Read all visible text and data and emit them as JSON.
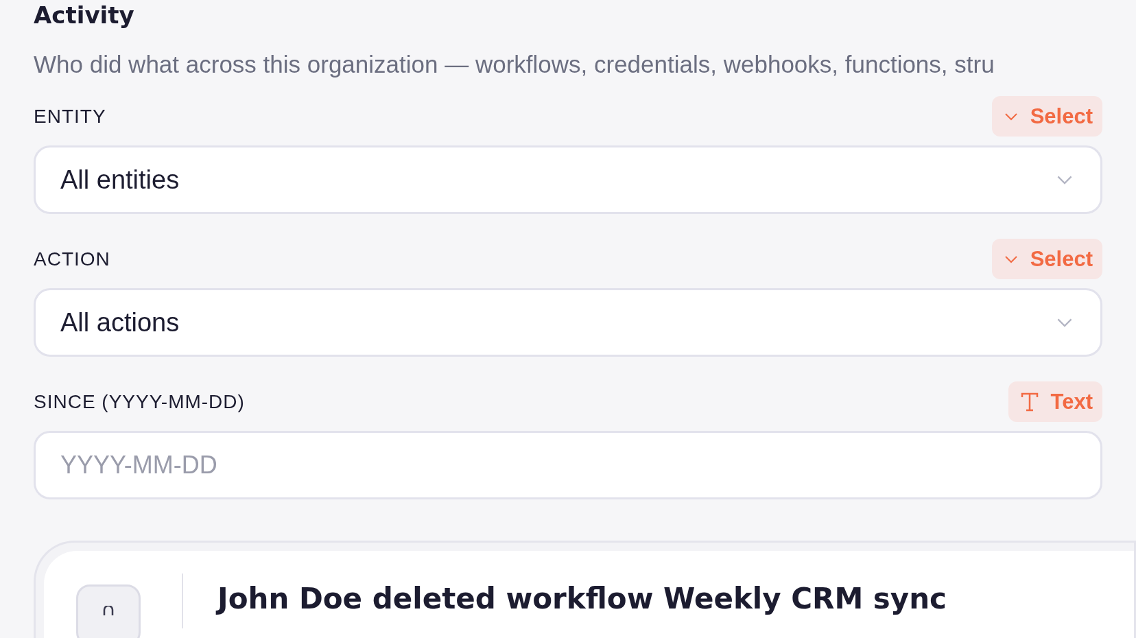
{
  "page": {
    "title": "Activity",
    "description": "Who did what across this organization — workflows, credentials, webhooks, functions, stru"
  },
  "filters": [
    {
      "label": "ENTITY",
      "hint": {
        "kind": "select",
        "text": "Select"
      },
      "control": {
        "kind": "select",
        "value": "All entities"
      }
    },
    {
      "label": "ACTION",
      "hint": {
        "kind": "select",
        "text": "Select"
      },
      "control": {
        "kind": "select",
        "value": "All actions"
      }
    },
    {
      "label": "SINCE (YYYY-MM-DD)",
      "hint": {
        "kind": "text",
        "text": "Text"
      },
      "control": {
        "kind": "text",
        "placeholder": "YYYY-MM-DD"
      }
    }
  ],
  "events": [
    {
      "title": "John Doe deleted workflow Weekly CRM sync"
    }
  ]
}
